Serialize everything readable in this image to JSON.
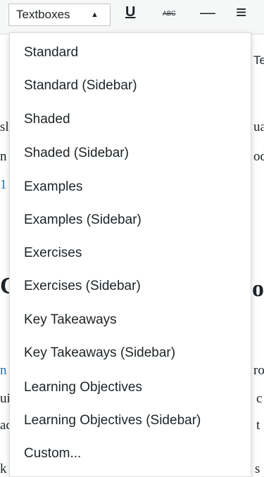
{
  "toolbar": {
    "format_dropdown_label": "Textboxes",
    "dropdown_caret": "▲",
    "underline_glyph": "U",
    "strike_glyph": "ABC",
    "hr_glyph": "—",
    "align_glyph": "≡"
  },
  "background": {
    "tab_fragment": "Te",
    "line1_left": "sl",
    "line1_right": "ua",
    "line2_left": "n",
    "line2_right": "od",
    "line3_left": "1",
    "heading_left": "C",
    "heading_right": "o",
    "para2_line1_left": "n",
    "para2_line1_right": "ro",
    "para2_line2_left": "ui",
    "para2_line2_right": "c",
    "para2_line3_left": "ac",
    "para2_line3_right": "t",
    "para2_line4_left": "k",
    "para2_line4_right": "s"
  },
  "menu": {
    "items": [
      {
        "label": "Standard"
      },
      {
        "label": "Standard (Sidebar)"
      },
      {
        "label": "Shaded"
      },
      {
        "label": "Shaded (Sidebar)"
      },
      {
        "label": "Examples"
      },
      {
        "label": "Examples (Sidebar)"
      },
      {
        "label": "Exercises"
      },
      {
        "label": "Exercises (Sidebar)"
      },
      {
        "label": "Key Takeaways"
      },
      {
        "label": "Key Takeaways (Sidebar)"
      },
      {
        "label": "Learning Objectives"
      },
      {
        "label": "Learning Objectives (Sidebar)"
      },
      {
        "label": "Custom..."
      }
    ]
  }
}
